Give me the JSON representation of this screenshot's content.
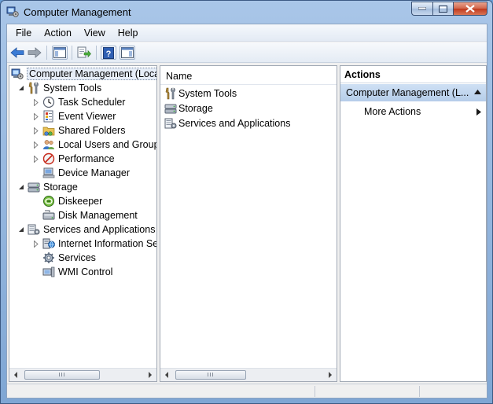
{
  "window": {
    "title": "Computer Management",
    "caption": {
      "minimize": "minimize",
      "maximize": "maximize",
      "close": "close"
    }
  },
  "menu": [
    "File",
    "Action",
    "View",
    "Help"
  ],
  "toolbar": {
    "buttons": [
      "back-icon",
      "forward-icon",
      "show-hide-console-tree-icon",
      "export-list-icon",
      "help-icon",
      "show-hide-action-pane-icon"
    ]
  },
  "tree": {
    "root": "Computer Management (Local",
    "items": [
      {
        "label": "System Tools",
        "level": 1,
        "expander": "expanded",
        "icon": "tools-icon"
      },
      {
        "label": "Task Scheduler",
        "level": 2,
        "expander": "collapsed",
        "icon": "clock-icon"
      },
      {
        "label": "Event Viewer",
        "level": 2,
        "expander": "collapsed",
        "icon": "event-viewer-icon"
      },
      {
        "label": "Shared Folders",
        "level": 2,
        "expander": "collapsed",
        "icon": "shared-folders-icon"
      },
      {
        "label": "Local Users and Groups",
        "level": 2,
        "expander": "collapsed",
        "icon": "users-icon"
      },
      {
        "label": "Performance",
        "level": 2,
        "expander": "collapsed",
        "icon": "performance-icon"
      },
      {
        "label": "Device Manager",
        "level": 2,
        "expander": "none",
        "icon": "device-manager-icon"
      },
      {
        "label": "Storage",
        "level": 1,
        "expander": "expanded",
        "icon": "storage-icon"
      },
      {
        "label": "Diskeeper",
        "level": 2,
        "expander": "none",
        "icon": "diskeeper-icon"
      },
      {
        "label": "Disk Management",
        "level": 2,
        "expander": "none",
        "icon": "disk-management-icon"
      },
      {
        "label": "Services and Applications",
        "level": 1,
        "expander": "expanded",
        "icon": "services-applications-icon"
      },
      {
        "label": "Internet Information Ser",
        "level": 2,
        "expander": "collapsed",
        "icon": "iis-icon"
      },
      {
        "label": "Services",
        "level": 2,
        "expander": "none",
        "icon": "services-gear-icon"
      },
      {
        "label": "WMI Control",
        "level": 2,
        "expander": "none",
        "icon": "wmi-control-icon"
      }
    ]
  },
  "center": {
    "column_header": "Name",
    "rows": [
      {
        "label": "System Tools",
        "icon": "tools-icon"
      },
      {
        "label": "Storage",
        "icon": "storage-icon"
      },
      {
        "label": "Services and Applications",
        "icon": "services-applications-icon"
      }
    ]
  },
  "actions": {
    "header": "Actions",
    "section": "Computer Management (L...",
    "items": [
      "More Actions"
    ]
  },
  "scrollbars": {
    "grip": "III"
  },
  "colors": {
    "title_bar": "#a9c6e8",
    "selection": "#e7eef8",
    "actions_section": "#c1d6ee",
    "toolbar_arrow": "#3a7bd5"
  }
}
